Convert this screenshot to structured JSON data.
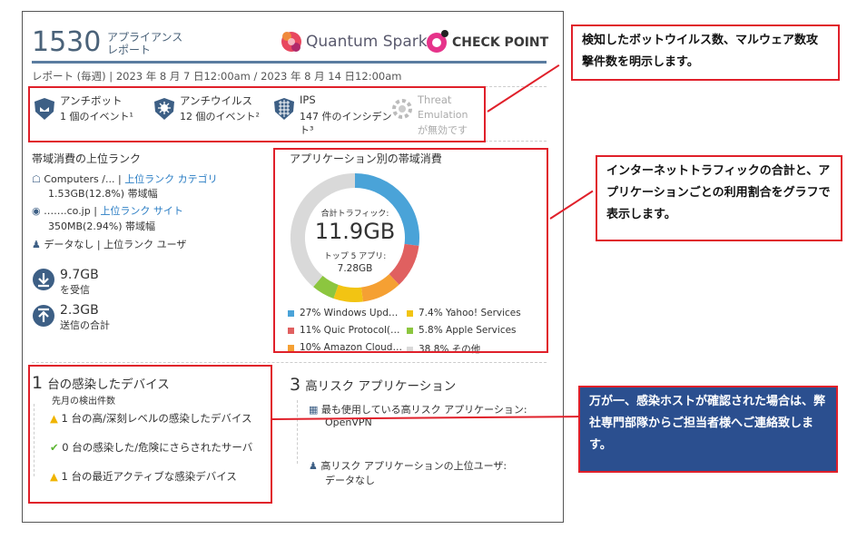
{
  "header": {
    "model_number": "1530",
    "model_label_line1": "アプライアンス",
    "model_label_line2": "レポート",
    "brand_left": "Quantum Spark",
    "brand_right": "CHECK POINT",
    "period": "レポート (毎週) | 2023 年 8 月 7 日12:00am / 2023 年 8 月 14 日12:00am"
  },
  "threats": [
    {
      "name": "アンチボット",
      "detail": "1 個のイベント¹",
      "detail2": ""
    },
    {
      "name": "アンチウイルス",
      "detail": "12 個のイベント²",
      "detail2": ""
    },
    {
      "name": "IPS",
      "detail": "147 件のインシデン",
      "detail2": "ト³"
    },
    {
      "name": "Threat",
      "detail": "Emulation",
      "detail2": "が無効です"
    }
  ],
  "bandwidth": {
    "title": "帯域消費の上位ランク",
    "category_value": "Computers /...",
    "category_link": "上位ランク カテゴリ",
    "category_usage": "1.53GB(12.8%) 帯域幅",
    "site_value": "…….co.jp",
    "site_link": "上位ランク サイト",
    "site_usage": "350MB(2.94%) 帯域幅",
    "user_value": "データなし | 上位ランク ユーザ",
    "received_value": "9.7GB",
    "received_label": "を受信",
    "sent_value": "2.3GB",
    "sent_label": "送信の合計"
  },
  "app_usage": {
    "title": "アプリケーション別の帯域消費",
    "total_label": "合計トラフィック:",
    "total_value": "11.9GB",
    "top5_label": "トップ 5 アプリ:",
    "top5_value": "7.28GB",
    "legend": [
      {
        "label": "27% Windows Upd…",
        "color": "#4aa3d8"
      },
      {
        "label": "7.4% Yahoo! Services",
        "color": "#f2c413"
      },
      {
        "label": "11% Quic Protocol(…",
        "color": "#e06060"
      },
      {
        "label": "5.8% Apple Services",
        "color": "#8cc63f"
      },
      {
        "label": "10% Amazon Cloud…",
        "color": "#f5a033"
      },
      {
        "label": "38.8% その他",
        "color": "#d9d9d9"
      }
    ]
  },
  "chart_data": {
    "type": "pie",
    "categories": [
      "Windows Upd…",
      "Quic Protocol(…",
      "Amazon Cloud…",
      "Yahoo! Services",
      "Apple Services",
      "その他"
    ],
    "values": [
      27,
      11,
      10,
      7.4,
      5.8,
      38.8
    ],
    "colors": [
      "#4aa3d8",
      "#e06060",
      "#f5a033",
      "#f2c413",
      "#8cc63f",
      "#d9d9d9"
    ]
  },
  "infected": {
    "count": "1",
    "title": "台の感染したデバイス",
    "subtitle": "先月の検出件数",
    "items": [
      "1 台の高/深刻レベルの感染したデバイス",
      "0 台の感染した/危険にさらされたサーバ",
      "1 台の最近アクティブな感染デバイス"
    ]
  },
  "risk_apps": {
    "count": "3",
    "title": "高リスク アプリケーション",
    "most_used_label": "最も使用している高リスク アプリケーション:",
    "most_used_value": "OpenVPN",
    "top_user_label": "高リスク アプリケーションの上位ユーザ:",
    "top_user_value": "データなし"
  },
  "callouts": {
    "threats": "検知したボットウイルス数、マルウェア数攻撃件数を明示します。",
    "traffic": "インターネットトラフィックの合計と、アプリケーションごとの利用割合をグラフで表示します。",
    "infected": "万が一、感染ホストが確認された場合は、弊社専門部隊からご担当者様へご連絡致します。"
  }
}
